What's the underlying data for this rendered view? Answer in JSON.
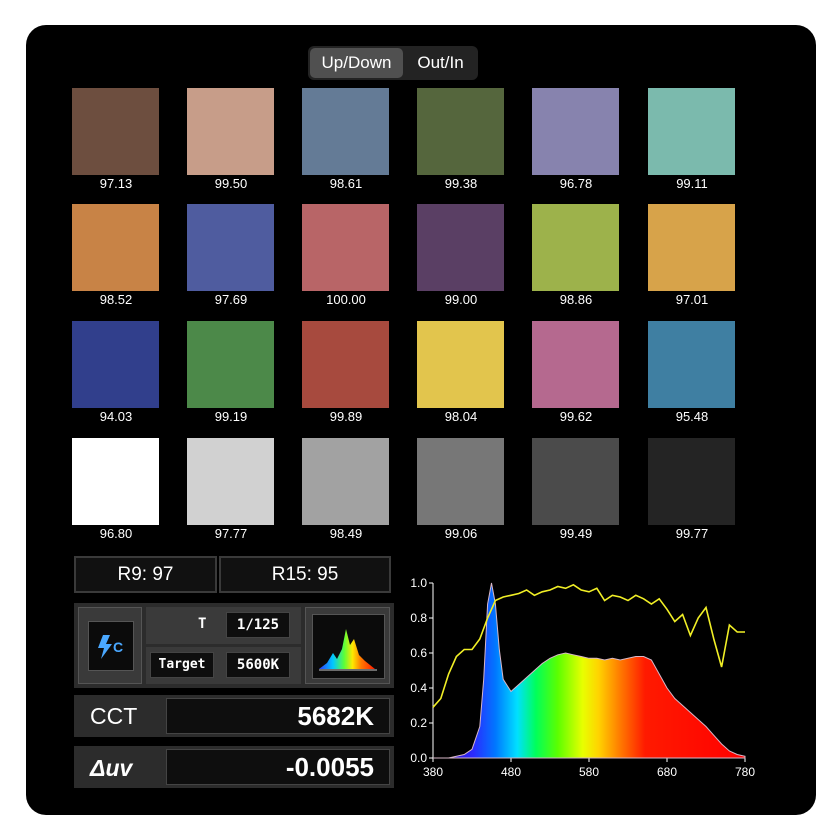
{
  "toggle": {
    "options": [
      "Up/Down",
      "Out/In"
    ],
    "selected": "Up/Down"
  },
  "swatches": [
    {
      "color": "#6d4e3f",
      "value": "97.13"
    },
    {
      "color": "#c79d89",
      "value": "99.50"
    },
    {
      "color": "#647b96",
      "value": "98.61"
    },
    {
      "color": "#55663d",
      "value": "99.38"
    },
    {
      "color": "#8783ae",
      "value": "96.78"
    },
    {
      "color": "#7bbaad",
      "value": "99.11"
    },
    {
      "color": "#c88346",
      "value": "98.52"
    },
    {
      "color": "#4f5c9f",
      "value": "97.69"
    },
    {
      "color": "#b86567",
      "value": "100.00"
    },
    {
      "color": "#5a3f64",
      "value": "99.00"
    },
    {
      "color": "#9db24b",
      "value": "98.86"
    },
    {
      "color": "#d7a34a",
      "value": "97.01"
    },
    {
      "color": "#313f8c",
      "value": "94.03"
    },
    {
      "color": "#4c8949",
      "value": "99.19"
    },
    {
      "color": "#a74a3e",
      "value": "99.89"
    },
    {
      "color": "#e2c54d",
      "value": "98.04"
    },
    {
      "color": "#b5698f",
      "value": "99.62"
    },
    {
      "color": "#3f7fa2",
      "value": "95.48"
    },
    {
      "color": "#ffffff",
      "value": "96.80"
    },
    {
      "color": "#d1d1d1",
      "value": "97.77"
    },
    {
      "color": "#a2a2a2",
      "value": "98.49"
    },
    {
      "color": "#777777",
      "value": "99.06"
    },
    {
      "color": "#4b4b4b",
      "value": "99.49"
    },
    {
      "color": "#242424",
      "value": "99.77"
    }
  ],
  "r9": "R9: 97",
  "r15": "R15: 95",
  "mode_icon": "bolt-c-icon",
  "shutter": {
    "label": "T",
    "value": "1/125"
  },
  "target": {
    "label": "Target",
    "value": "5600K"
  },
  "spectrum_icon": "spectrum-icon",
  "cct": {
    "label": "CCT",
    "value": "5682K"
  },
  "duv": {
    "label": "Δuv",
    "value": "-0.0055"
  },
  "chart_data": {
    "type": "area",
    "x_ticks": [
      380,
      480,
      580,
      680,
      780
    ],
    "y_ticks": [
      "0.0",
      "0.2",
      "0.4",
      "0.6",
      "0.8",
      "1.0"
    ],
    "xlim": [
      380,
      780
    ],
    "ylim": [
      0,
      1
    ],
    "series": [
      {
        "x": [
          380,
          400,
          420,
          430,
          440,
          445,
          450,
          455,
          460,
          465,
          470,
          480,
          490,
          500,
          510,
          520,
          530,
          540,
          550,
          560,
          570,
          580,
          590,
          600,
          610,
          620,
          630,
          640,
          650,
          660,
          670,
          680,
          690,
          700,
          710,
          720,
          730,
          740,
          750,
          760,
          770,
          780
        ],
        "y": [
          0.0,
          0.0,
          0.02,
          0.05,
          0.18,
          0.45,
          0.88,
          1.0,
          0.88,
          0.62,
          0.45,
          0.38,
          0.42,
          0.46,
          0.5,
          0.54,
          0.57,
          0.59,
          0.6,
          0.59,
          0.58,
          0.57,
          0.57,
          0.56,
          0.57,
          0.56,
          0.57,
          0.58,
          0.58,
          0.56,
          0.48,
          0.4,
          0.34,
          0.3,
          0.26,
          0.22,
          0.18,
          0.13,
          0.08,
          0.04,
          0.02,
          0.01
        ],
        "color": "spectrum"
      },
      {
        "x": [
          380,
          390,
          400,
          410,
          420,
          430,
          440,
          450,
          460,
          470,
          480,
          490,
          500,
          510,
          520,
          530,
          540,
          550,
          560,
          570,
          580,
          590,
          600,
          610,
          620,
          630,
          640,
          650,
          660,
          670,
          680,
          690,
          700,
          710,
          720,
          730,
          740,
          750,
          760,
          770,
          780
        ],
        "y": [
          0.29,
          0.34,
          0.48,
          0.58,
          0.62,
          0.62,
          0.68,
          0.8,
          0.9,
          0.92,
          0.93,
          0.94,
          0.96,
          0.93,
          0.95,
          0.96,
          0.98,
          0.97,
          0.99,
          0.96,
          0.95,
          0.97,
          0.9,
          0.93,
          0.92,
          0.9,
          0.93,
          0.91,
          0.88,
          0.91,
          0.85,
          0.78,
          0.82,
          0.7,
          0.8,
          0.86,
          0.68,
          0.52,
          0.76,
          0.72,
          0.72
        ],
        "color": "#f1ef26"
      }
    ]
  }
}
